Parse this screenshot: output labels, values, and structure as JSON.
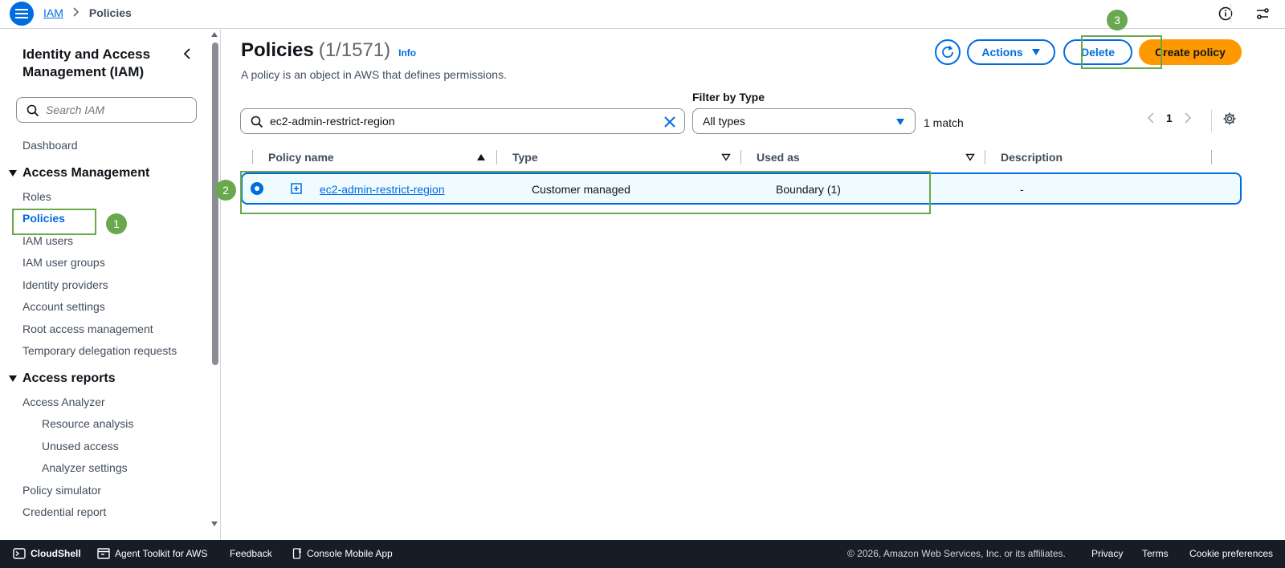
{
  "topbar": {
    "menu_icon": "hamburger-icon",
    "breadcrumbs": [
      "IAM",
      "Policies"
    ],
    "separator": ">",
    "right_icons": [
      "info-icon",
      "settings-toggle-icon"
    ]
  },
  "sidebar": {
    "title": "Identity and Access Management (IAM)",
    "search_placeholder": "Search IAM",
    "dashboard": "Dashboard",
    "section_access_management": "Access Management",
    "access_management_items": [
      "Roles",
      "Policies",
      "IAM users",
      "IAM user groups",
      "Identity providers",
      "Account settings",
      "Root access management",
      "Temporary delegation requests"
    ],
    "section_access_reports": "Access reports",
    "access_reports_items": [
      "Access Analyzer"
    ],
    "access_analyzer_sub": [
      "Resource analysis",
      "Unused access",
      "Analyzer settings"
    ],
    "other_items": [
      "Policy simulator",
      "Credential report"
    ]
  },
  "main": {
    "title": "Policies",
    "count": "(1/1571)",
    "info": "Info",
    "description": "A policy is an object in AWS that defines permissions.",
    "actions_label": "Actions",
    "delete_label": "Delete",
    "create_label": "Create policy",
    "filter_label": "Filter by Type",
    "search_value": "ec2-admin-restrict-region",
    "select_value": "All types",
    "match_text": "1 match",
    "page_number": "1",
    "columns": [
      "Policy name",
      "Type",
      "Used as",
      "Description"
    ],
    "row": {
      "policy_name": "ec2-admin-restrict-region",
      "type": "Customer managed",
      "used_as": "Boundary (1)",
      "description": "-"
    }
  },
  "annotations": [
    "1",
    "2",
    "3"
  ],
  "footer": {
    "cloudshell": "CloudShell",
    "agent_toolkit": "Agent Toolkit for AWS",
    "feedback": "Feedback",
    "mobile_app": "Console Mobile App",
    "copyright": "© 2026, Amazon Web Services, Inc. or its affiliates.",
    "privacy": "Privacy",
    "terms": "Terms",
    "cookies": "Cookie preferences"
  },
  "colors": {
    "accent": "#006ce0",
    "primary_button": "#ff9900",
    "annotation": "#6aa84f",
    "footer_bg": "#161d26",
    "selected_row_bg": "#f0fbff"
  }
}
